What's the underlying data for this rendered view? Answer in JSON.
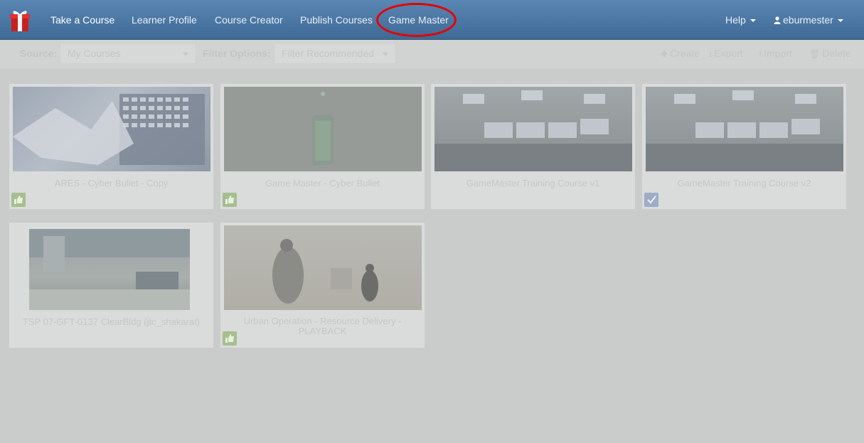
{
  "nav": {
    "items": [
      {
        "label": "Take a Course",
        "active": true
      },
      {
        "label": "Learner Profile",
        "active": false
      },
      {
        "label": "Course Creator",
        "active": false
      },
      {
        "label": "Publish Courses",
        "active": false
      },
      {
        "label": "Game Master",
        "active": false
      }
    ],
    "help": "Help",
    "user": "eburmester",
    "logo_icon": "gift-box-icon",
    "user_icon": "user-icon",
    "highlight_color": "#e60000",
    "accent_color": "#4a76a4"
  },
  "toolbar": {
    "source_label": "Source:",
    "source_value": "My Courses",
    "filter_label": "Filter Options:",
    "filter_value": "Filter Recommended",
    "create": "Create",
    "export": "Export",
    "import": "Import",
    "delete": "Delete",
    "create_icon": "plus-icon",
    "export_icon": "download-icon",
    "import_icon": "upload-icon",
    "delete_icon": "trash-icon"
  },
  "courses": [
    {
      "title": "ARES - Cyber Bullet - Copy",
      "badge": "thumbs-up-icon"
    },
    {
      "title": "Game Master - Cyber Bullet",
      "badge": "thumbs-up-icon"
    },
    {
      "title": "GameMaster Training Course v1",
      "badge": ""
    },
    {
      "title": "GameMaster Training Course v2",
      "badge": "checkbox-checked-icon"
    },
    {
      "title": "TSP 07-GFT-0137 ClearBldg (jtc_shakarat)",
      "badge": ""
    },
    {
      "title": "Urban Operation - Resource Delivery - PLAYBACK",
      "badge": "thumbs-up-icon"
    }
  ]
}
